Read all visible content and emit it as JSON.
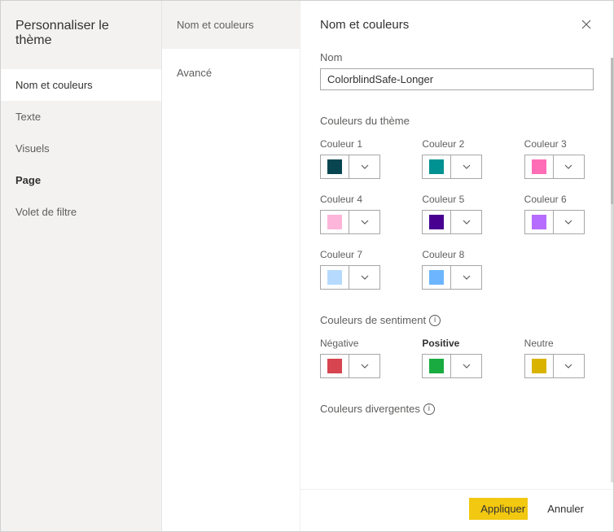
{
  "dialog": {
    "title": "Personnaliser le thème",
    "panel_title": "Nom et couleurs"
  },
  "sidebar_left": [
    {
      "label": "Nom et couleurs",
      "active": true,
      "bold": false
    },
    {
      "label": "Texte",
      "active": false,
      "bold": false
    },
    {
      "label": "Visuels",
      "active": false,
      "bold": false
    },
    {
      "label": "Page",
      "active": false,
      "bold": true
    },
    {
      "label": "Volet de filtre",
      "active": false,
      "bold": false
    }
  ],
  "sidebar_mid": [
    {
      "label": "Nom et couleurs",
      "active": true
    },
    {
      "label": "Avancé",
      "active": false
    }
  ],
  "name_field": {
    "label": "Nom",
    "value": "ColorblindSafe-Longer"
  },
  "theme_colors": {
    "label": "Couleurs du thème",
    "items": [
      {
        "label": "Couleur 1",
        "hex": "#074650"
      },
      {
        "label": "Couleur 2",
        "hex": "#009292"
      },
      {
        "label": "Couleur 3",
        "hex": "#fe6db6"
      },
      {
        "label": "Couleur 4",
        "hex": "#feb5da"
      },
      {
        "label": "Couleur 5",
        "hex": "#480091"
      },
      {
        "label": "Couleur 6",
        "hex": "#b66dff"
      },
      {
        "label": "Couleur 7",
        "hex": "#b5dafe"
      },
      {
        "label": "Couleur 8",
        "hex": "#6db6ff"
      }
    ]
  },
  "sentiment_colors": {
    "label": "Couleurs de sentiment",
    "items": [
      {
        "label": "Négative",
        "hex": "#d64550",
        "bold": false
      },
      {
        "label": "Positive",
        "hex": "#1aab40",
        "bold": true
      },
      {
        "label": "Neutre",
        "hex": "#d9b300",
        "bold": false
      }
    ]
  },
  "divergent_colors": {
    "label": "Couleurs divergentes"
  },
  "footer": {
    "apply": "Appliquer",
    "cancel": "Annuler"
  }
}
